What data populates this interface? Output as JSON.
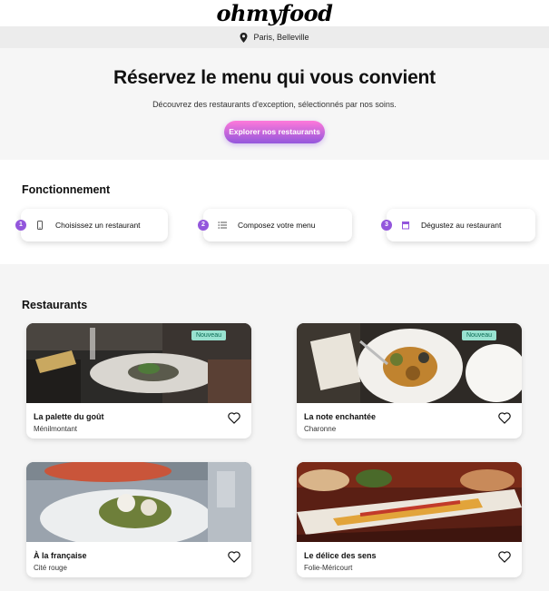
{
  "brand": {
    "logo": "ohmyfood"
  },
  "location": {
    "text": "Paris, Belleville",
    "icon": "map-pin-icon"
  },
  "hero": {
    "title": "Réservez le menu qui vous convient",
    "subtitle": "Découvrez des restaurants d'exception, sélectionnés par nos soins.",
    "cta_label": "Explorer nos restaurants"
  },
  "how": {
    "title": "Fonctionnement",
    "steps": [
      {
        "num": "1",
        "label": "Choisissez un restaurant",
        "icon": "phone-icon"
      },
      {
        "num": "2",
        "label": "Composez votre menu",
        "icon": "list-icon"
      },
      {
        "num": "3",
        "label": "Dégustez au restaurant",
        "icon": "store-icon"
      }
    ]
  },
  "restaurants": {
    "title": "Restaurants",
    "cards": [
      {
        "name": "La palette du goût",
        "area": "Ménilmontant",
        "badge": "Nouveau"
      },
      {
        "name": "La note enchantée",
        "area": "Charonne",
        "badge": "Nouveau"
      },
      {
        "name": "À la française",
        "area": "Cité rouge",
        "badge": ""
      },
      {
        "name": "Le délice des sens",
        "area": "Folie-Méricourt",
        "badge": ""
      }
    ]
  },
  "colors": {
    "accent_start": "#ff79da",
    "accent_end": "#9356dc",
    "badge_bg": "#99e2d0"
  }
}
